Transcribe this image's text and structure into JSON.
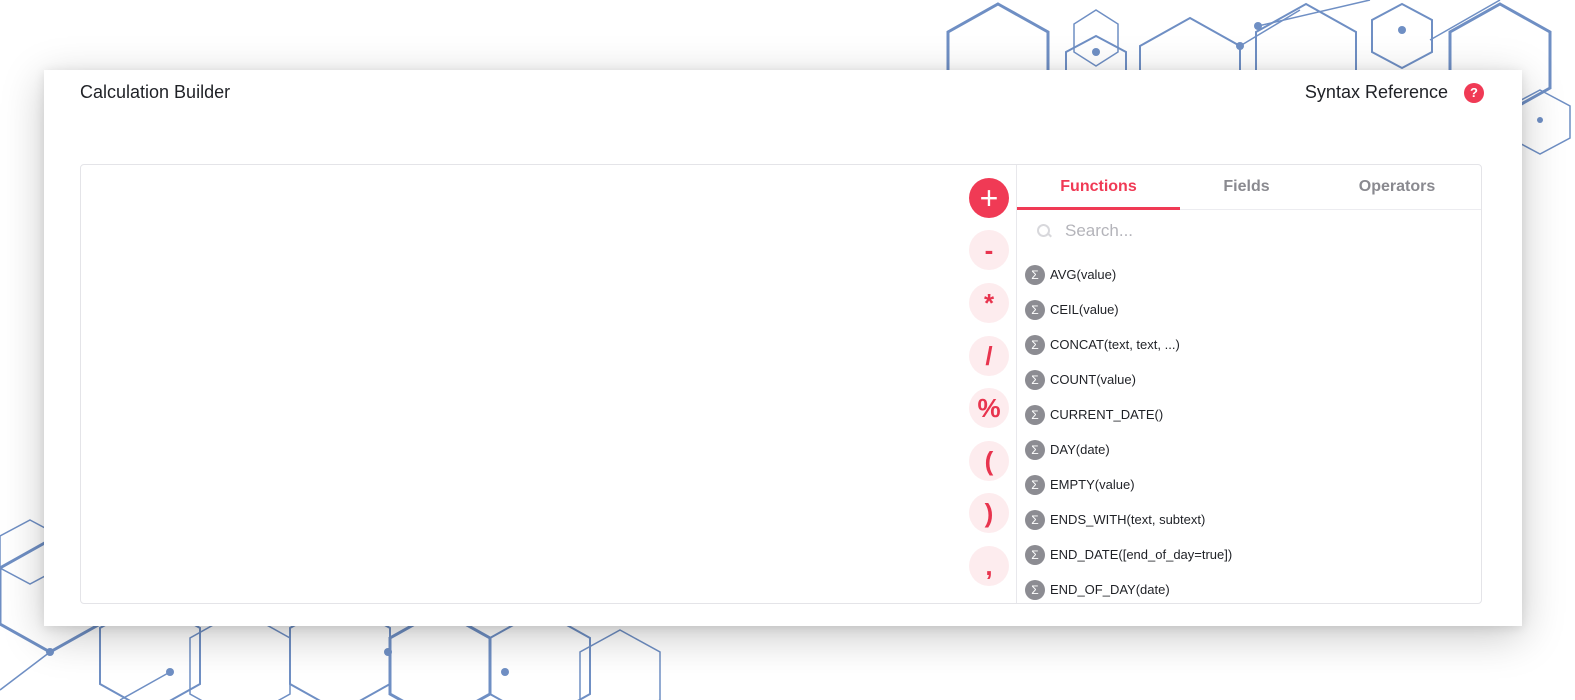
{
  "header": {
    "title": "Calculation Builder",
    "syntax_reference": "Syntax Reference",
    "help_symbol": "?"
  },
  "operators": [
    {
      "symbol": "+",
      "name": "plus"
    },
    {
      "symbol": "-",
      "name": "minus"
    },
    {
      "symbol": "*",
      "name": "multiply"
    },
    {
      "symbol": "/",
      "name": "divide"
    },
    {
      "symbol": "%",
      "name": "percent"
    },
    {
      "symbol": "(",
      "name": "open-paren"
    },
    {
      "symbol": ")",
      "name": "close-paren"
    },
    {
      "symbol": ",",
      "name": "comma"
    }
  ],
  "tabs": [
    {
      "label": "Functions",
      "active": true
    },
    {
      "label": "Fields",
      "active": false
    },
    {
      "label": "Operators",
      "active": false
    }
  ],
  "search": {
    "placeholder": "Search...",
    "value": ""
  },
  "functions": [
    "AVG(value)",
    "CEIL(value)",
    "CONCAT(text, text, ...)",
    "COUNT(value)",
    "CURRENT_DATE()",
    "DAY(date)",
    "EMPTY(value)",
    "ENDS_WITH(text, subtext)",
    "END_DATE([end_of_day=true])",
    "END_OF_DAY(date)"
  ],
  "function_icon": "sigma-icon",
  "colors": {
    "accent": "#f03a55",
    "accent_soft": "#fdecee",
    "hex_lines": "#6f8fc4"
  }
}
